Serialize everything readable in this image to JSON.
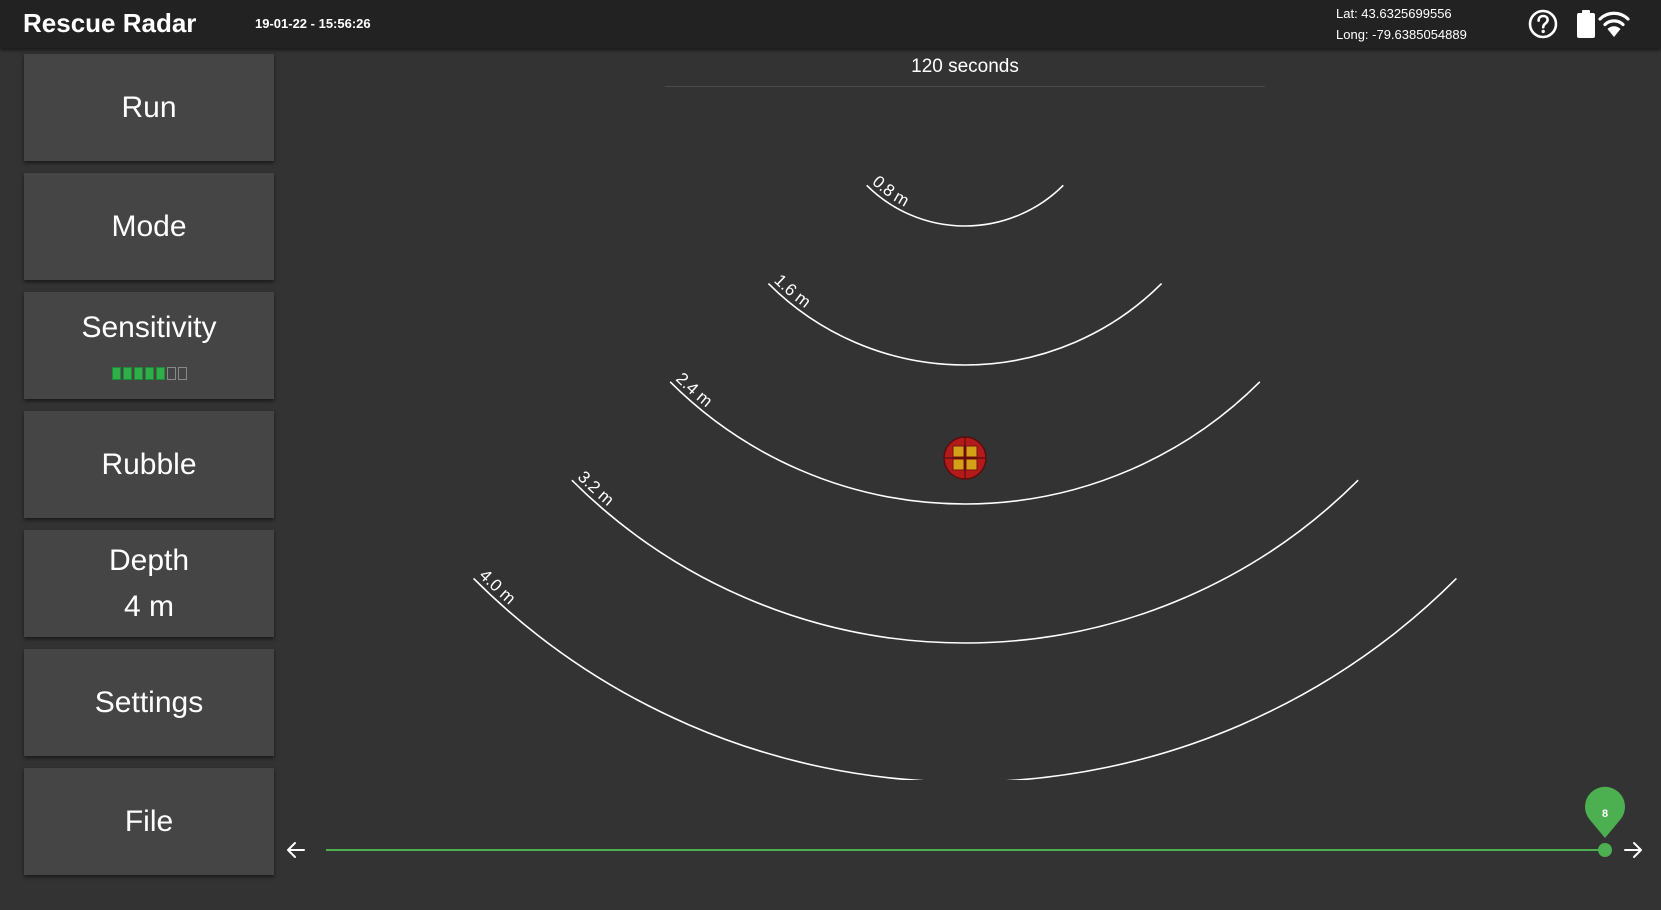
{
  "app": {
    "title": "Rescue Radar",
    "datetime": "19-01-22 - 15:56:26"
  },
  "gps": {
    "lat_label": "Lat: 43.6325699556",
    "long_label": "Long: -79.6385054889"
  },
  "status_icons": [
    "help-icon",
    "battery-icon",
    "wifi-icon"
  ],
  "sidebar": {
    "run": "Run",
    "mode": "Mode",
    "sensitivity": {
      "label": "Sensitivity",
      "level": 5,
      "max": 7
    },
    "rubble": "Rubble",
    "depth": {
      "label": "Depth",
      "value": "4 m"
    },
    "settings": "Settings",
    "file": "File"
  },
  "radar": {
    "duration_label": "120 seconds",
    "rings": [
      {
        "label": "0.8 m",
        "depth": 0.8
      },
      {
        "label": "1.6 m",
        "depth": 1.6
      },
      {
        "label": "2.4 m",
        "depth": 2.4
      },
      {
        "label": "3.2 m",
        "depth": 3.2
      },
      {
        "label": "4.0 m",
        "depth": 4.0
      }
    ],
    "target": {
      "depth": 2.4,
      "icon": "target-grid-icon"
    }
  },
  "timeline": {
    "value_label": "8",
    "position": 1.0
  },
  "colors": {
    "background": "#333333",
    "topbar": "#222222",
    "button": "#454545",
    "accent": "#4caf50",
    "target": "#d4a017",
    "target_border": "#b31b1b"
  }
}
